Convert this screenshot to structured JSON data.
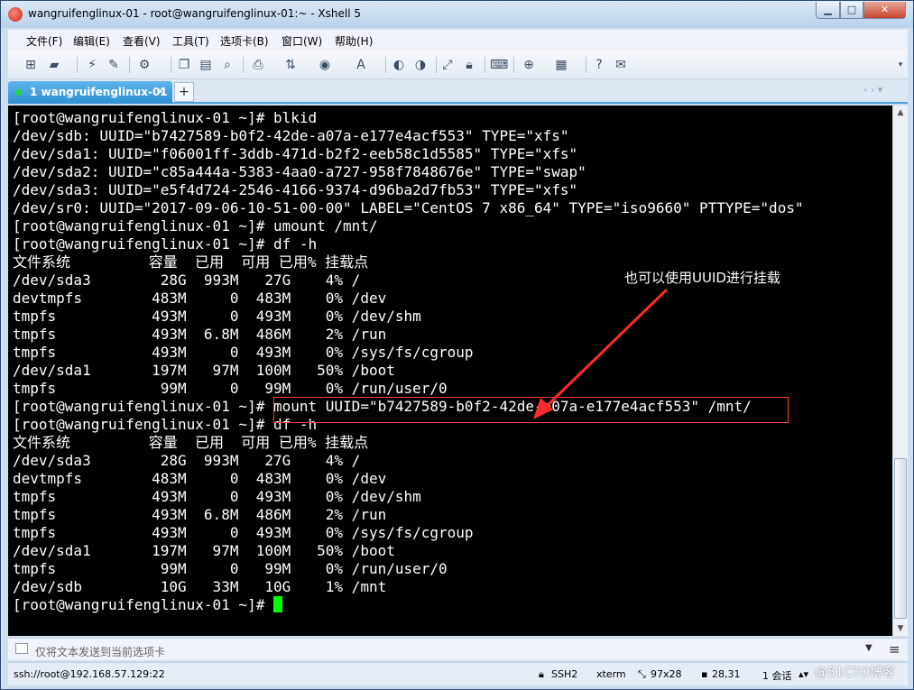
{
  "window": {
    "title": "wangruifenglinux-01 - root@wangruifenglinux-01:~ - Xshell 5",
    "controls": {
      "minimize": "▁",
      "maximize": "□",
      "close": "✕"
    }
  },
  "menu": [
    "文件(F)",
    "编辑(E)",
    "查看(V)",
    "工具(T)",
    "选项卡(B)",
    "窗口(W)",
    "帮助(H)"
  ],
  "tab": {
    "label": "1 wangruifenglinux-01",
    "close": "×",
    "add": "+",
    "nav": "‹ › ▾"
  },
  "terminal": {
    "lines": [
      "[root@wangruifenglinux-01 ~]# blkid",
      "/dev/sdb: UUID=\"b7427589-b0f2-42de-a07a-e177e4acf553\" TYPE=\"xfs\"",
      "/dev/sda1: UUID=\"f06001ff-3ddb-471d-b2f2-eeb58c1d5585\" TYPE=\"xfs\"",
      "/dev/sda2: UUID=\"c85a444a-5383-4aa0-a727-958f7848676e\" TYPE=\"swap\"",
      "/dev/sda3: UUID=\"e5f4d724-2546-4166-9374-d96ba2d7fb53\" TYPE=\"xfs\"",
      "/dev/sr0: UUID=\"2017-09-06-10-51-00-00\" LABEL=\"CentOS 7 x86_64\" TYPE=\"iso9660\" PTTYPE=\"dos\"",
      "[root@wangruifenglinux-01 ~]# umount /mnt/",
      "[root@wangruifenglinux-01 ~]# df -h",
      "文件系统         容量  已用  可用 已用% 挂载点",
      "/dev/sda3        28G  993M   27G    4% /",
      "devtmpfs        483M     0  483M    0% /dev",
      "tmpfs           493M     0  493M    0% /dev/shm",
      "tmpfs           493M  6.8M  486M    2% /run",
      "tmpfs           493M     0  493M    0% /sys/fs/cgroup",
      "/dev/sda1       197M   97M  100M   50% /boot",
      "tmpfs            99M     0   99M    0% /run/user/0",
      "[root@wangruifenglinux-01 ~]# mount UUID=\"b7427589-b0f2-42de-a07a-e177e4acf553\" /mnt/",
      "[root@wangruifenglinux-01 ~]# df -h",
      "文件系统         容量  已用  可用 已用% 挂载点",
      "/dev/sda3        28G  993M   27G    4% /",
      "devtmpfs        483M     0  483M    0% /dev",
      "tmpfs           493M     0  493M    0% /dev/shm",
      "tmpfs           493M  6.8M  486M    2% /run",
      "tmpfs           493M     0  493M    0% /sys/fs/cgroup",
      "/dev/sda1       197M   97M  100M   50% /boot",
      "tmpfs            99M     0   99M    0% /run/user/0",
      "/dev/sdb         10G   33M   10G    1% /mnt"
    ],
    "prompt": "[root@wangruifenglinux-01 ~]# ",
    "annotation": "也可以使用UUID进行挂载",
    "colors": {
      "background": "#000000",
      "text": "#ffffff",
      "cursor": "#00ff00",
      "highlight": "#ff3a3a"
    }
  },
  "compose": {
    "placeholder": "仅将文本发送到当前选项卡"
  },
  "status": {
    "connection": "ssh://root@192.168.57.129:22",
    "protocol": "SSH2",
    "terminal_type": "xterm",
    "size": "97x28",
    "cursor_pos": "28,31",
    "sessions": "1 会话",
    "watermark": "@51CTO博客"
  }
}
